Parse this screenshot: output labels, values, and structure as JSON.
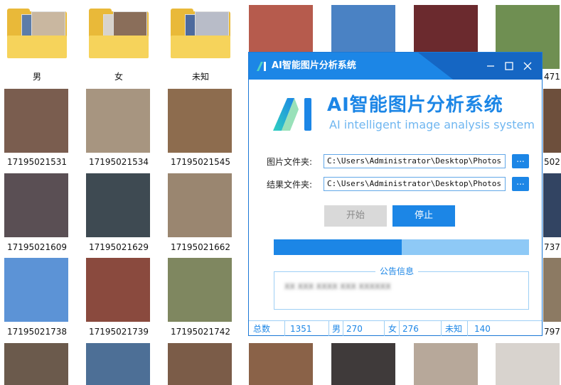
{
  "folders": [
    {
      "label": "男"
    },
    {
      "label": "女"
    },
    {
      "label": "未知"
    }
  ],
  "photos": [
    {
      "label": "17195021531"
    },
    {
      "label": "17195021534"
    },
    {
      "label": "17195021545"
    },
    {
      "label": "17195021609"
    },
    {
      "label": "17195021629"
    },
    {
      "label": "17195021662"
    },
    {
      "label": "17195021738"
    },
    {
      "label": "17195021739"
    },
    {
      "label": "17195021742"
    }
  ],
  "partial_labels": {
    "r0": "471",
    "r1": "502",
    "r2": "737",
    "r3": "797"
  },
  "dialog": {
    "title": "AI智能图片分析系统",
    "brand_title": "AI智能图片分析系统",
    "brand_subtitle": "AI intelligent image analysis system",
    "image_folder_label": "图片文件夹:",
    "image_folder_value": "C:\\Users\\Administrator\\Desktop\\Photos",
    "result_folder_label": "结果文件夹:",
    "result_folder_value": "C:\\Users\\Administrator\\Desktop\\Photos",
    "browse_label": "...",
    "start_label": "开始",
    "stop_label": "停止",
    "progress": 0.5,
    "notice_title": "公告信息",
    "notice_text": "XX XXX XXXX XXX XXXXXX",
    "status": {
      "total_label": "总数",
      "total_value": "1351",
      "male_label": "男",
      "male_value": "270",
      "female_label": "女",
      "female_value": "276",
      "unknown_label": "未知",
      "unknown_value": "140"
    }
  },
  "colors": {
    "accent": "#1c86e6",
    "accent_dark": "#1566c3",
    "progress_track": "#8ec9f6",
    "folder": "#e9b939"
  }
}
